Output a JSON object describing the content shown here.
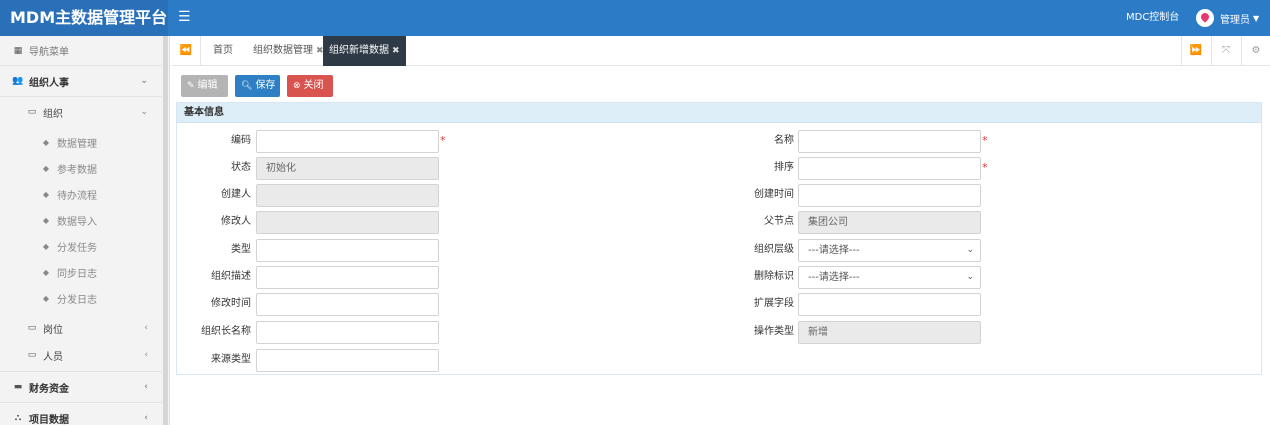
{
  "app": {
    "title": "MDM主数据管理平台",
    "console_label": "MDC控制台",
    "user_label": "管理员",
    "accent_color": "#2b7bc6"
  },
  "sidebar": {
    "nav_label": "导航菜单",
    "groups": [
      {
        "label": "组织人事",
        "icon": "users-icon",
        "expanded": true
      },
      {
        "label": "财务资金",
        "icon": "credit-card-icon",
        "expanded": false
      },
      {
        "label": "项目数据",
        "icon": "sitemap-icon",
        "expanded": false
      }
    ],
    "sub_groups": [
      {
        "label": "组织",
        "icon": "folder-icon",
        "expanded": true
      },
      {
        "label": "岗位",
        "icon": "folder-icon",
        "expanded": false
      },
      {
        "label": "人员",
        "icon": "folder-icon",
        "expanded": false
      }
    ],
    "items": [
      {
        "label": "数据管理",
        "icon": "tag-icon"
      },
      {
        "label": "参考数据",
        "icon": "tag-icon"
      },
      {
        "label": "待办流程",
        "icon": "tag-icon"
      },
      {
        "label": "数据导入",
        "icon": "tag-icon"
      },
      {
        "label": "分发任务",
        "icon": "tag-icon"
      },
      {
        "label": "同步日志",
        "icon": "tag-icon"
      },
      {
        "label": "分发日志",
        "icon": "tag-icon"
      }
    ]
  },
  "tabs": [
    {
      "label": "首页",
      "closable": false,
      "active": false
    },
    {
      "label": "组织数据管理",
      "closable": true,
      "active": false
    },
    {
      "label": "组织新增数据",
      "closable": true,
      "active": true
    }
  ],
  "toolbar": {
    "edit_label": "编辑",
    "save_label": "保存",
    "close_label": "关闭"
  },
  "form": {
    "section_title": "基本信息",
    "left_fields": [
      {
        "label": "编码",
        "value": "",
        "readonly": false,
        "required": true
      },
      {
        "label": "状态",
        "value": "初始化",
        "readonly": true,
        "required": false
      },
      {
        "label": "创建人",
        "value": "",
        "readonly": true,
        "required": false
      },
      {
        "label": "修改人",
        "value": "",
        "readonly": true,
        "required": false
      },
      {
        "label": "类型",
        "value": "",
        "readonly": false,
        "required": false
      },
      {
        "label": "组织描述",
        "value": "",
        "readonly": false,
        "required": false
      },
      {
        "label": "修改时间",
        "value": "",
        "readonly": false,
        "required": false
      },
      {
        "label": "组织长名称",
        "value": "",
        "readonly": false,
        "required": false
      },
      {
        "label": "来源类型",
        "value": "",
        "readonly": false,
        "required": false
      }
    ],
    "right_fields": [
      {
        "label": "名称",
        "value": "",
        "readonly": false,
        "required": true,
        "select": false
      },
      {
        "label": "排序",
        "value": "",
        "readonly": false,
        "required": true,
        "select": false
      },
      {
        "label": "创建时间",
        "value": "",
        "readonly": false,
        "required": false,
        "select": false
      },
      {
        "label": "父节点",
        "value": "集团公司",
        "readonly": true,
        "required": false,
        "select": false
      },
      {
        "label": "组织层级",
        "value": "---请选择---",
        "readonly": false,
        "required": false,
        "select": true
      },
      {
        "label": "删除标识",
        "value": "---请选择---",
        "readonly": false,
        "required": false,
        "select": true
      },
      {
        "label": "扩展字段",
        "value": "",
        "readonly": false,
        "required": false,
        "select": false
      },
      {
        "label": "操作类型",
        "value": "新增",
        "readonly": true,
        "required": false,
        "select": false
      }
    ]
  }
}
